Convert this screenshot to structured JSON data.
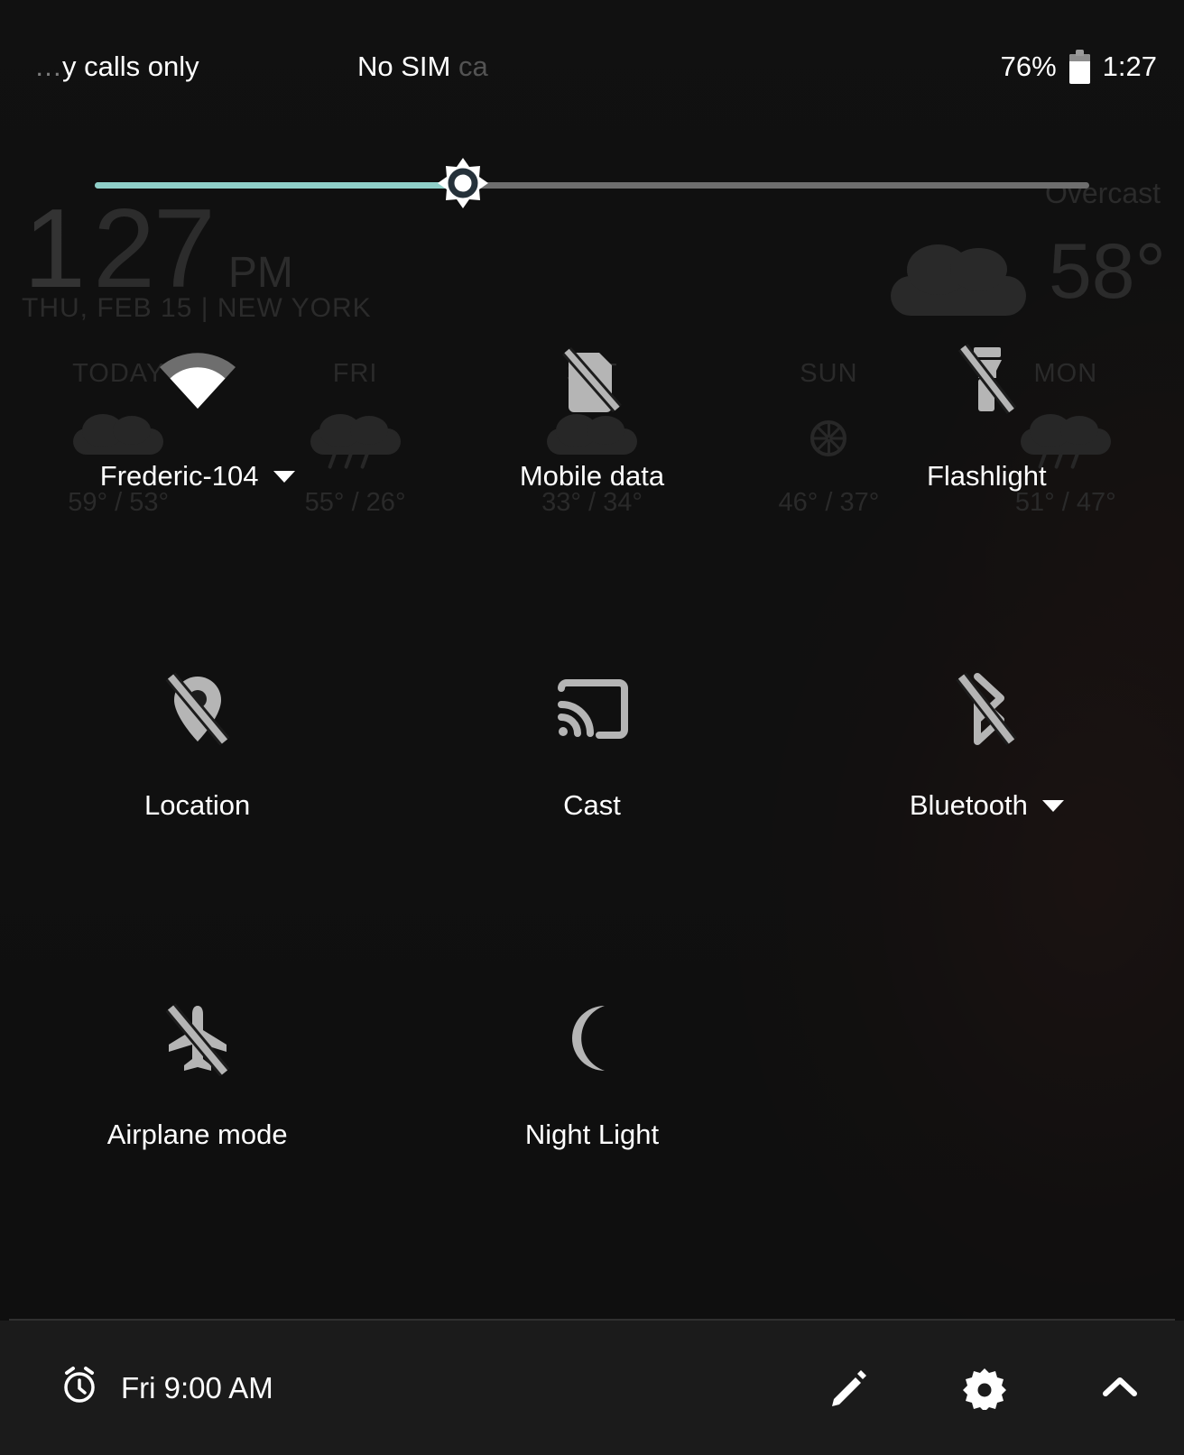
{
  "status_bar": {
    "carrier_text": "y calls only",
    "carrier_fade_prefix": "",
    "sim_text": "No SIM ",
    "sim_text_fade": "ca",
    "battery_percent": "76%",
    "clock": "1:27",
    "battery_icon": "battery-icon"
  },
  "brightness": {
    "name": "brightness-slider",
    "value_percent": 37,
    "fill_color": "#8fcfc8",
    "track_color": "#6e6e6e",
    "thumb_icon": "brightness-sun-icon"
  },
  "tiles": [
    {
      "id": "wifi",
      "label": "Frederic-104",
      "icon": "wifi-icon",
      "state": "on",
      "has_caret": true
    },
    {
      "id": "mobile-data",
      "label": "Mobile data",
      "icon": "mobile-data-off-icon",
      "state": "off",
      "has_caret": false
    },
    {
      "id": "flashlight",
      "label": "Flashlight",
      "icon": "flashlight-off-icon",
      "state": "off",
      "has_caret": false
    },
    {
      "id": "location",
      "label": "Location",
      "icon": "location-off-icon",
      "state": "off",
      "has_caret": false
    },
    {
      "id": "cast",
      "label": "Cast",
      "icon": "cast-icon",
      "state": "off",
      "has_caret": false
    },
    {
      "id": "bluetooth",
      "label": "Bluetooth",
      "icon": "bluetooth-off-icon",
      "state": "off",
      "has_caret": true
    },
    {
      "id": "airplane-mode",
      "label": "Airplane mode",
      "icon": "airplane-off-icon",
      "state": "off",
      "has_caret": false
    },
    {
      "id": "night-light",
      "label": "Night Light",
      "icon": "night-light-moon-icon",
      "state": "off",
      "has_caret": false
    }
  ],
  "footer": {
    "alarm_icon": "alarm-clock-icon",
    "alarm_text": "Fri 9:00 AM",
    "edit_icon": "pencil-edit-icon",
    "settings_icon": "gear-settings-icon",
    "collapse_icon": "chevron-up-icon"
  },
  "background_widget": {
    "clock_hour": "1",
    "clock_minute": "27",
    "clock_ampm": "PM",
    "date_location": "THU, FEB 15 | NEW YORK",
    "condition": "Overcast",
    "temperature": "58°",
    "forecast": [
      {
        "day": "TODAY",
        "icon": "cloud-icon",
        "temps": "59° / 53°"
      },
      {
        "day": "FRI",
        "icon": "rain-cloud-icon",
        "temps": "55° / 26°"
      },
      {
        "day": "SAT",
        "icon": "cloud-icon",
        "temps": "33° / 34°"
      },
      {
        "day": "SUN",
        "icon": "sun-icon",
        "temps": "46° / 37°"
      },
      {
        "day": "MON",
        "icon": "rain-cloud-icon",
        "temps": "51° / 47°"
      }
    ]
  },
  "colors": {
    "panel_background": "#1c1c1c",
    "accent_teal": "#8fcfc8",
    "icon_on": "#ffffff",
    "icon_off": "#b5b5b5",
    "text_primary": "#ffffff"
  }
}
